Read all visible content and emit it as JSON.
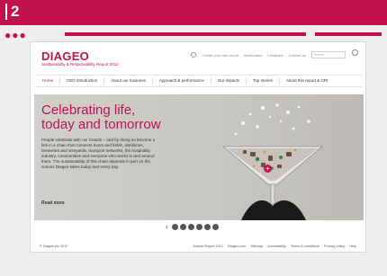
{
  "slide_number": "2",
  "brand": {
    "name": "DIAGEO",
    "subtitle": "Sustainability & Responsibility Report 2012"
  },
  "utility": {
    "create_report": "Create your own report",
    "bookmarks": "Bookmarks",
    "feedback": "Feedback",
    "contact": "Contact us",
    "search_placeholder": "Search"
  },
  "nav": [
    "Home",
    "CEO introduction",
    "About our business",
    "Approach & performance",
    "Our impacts",
    "Top stories",
    "About this report & GRI"
  ],
  "hero": {
    "headline_1": "Celebrating life,",
    "headline_2": "today and tomorrow",
    "body": "People celebrate with our brands – and by doing so become a link in a chain that connects rivers and fields, distilleries, breweries and vineyards, transport networks, the hospitality industry, communities and everyone who works in and around them. The sustainability of this chain depends in part on the actions Diageo takes today and every day.",
    "read_more": "Read more",
    "plus": "+"
  },
  "pager": {
    "current": "1"
  },
  "footer": {
    "copyright": "© Diageo plc 2012",
    "links": [
      "Annual Report 2012",
      "Diageo.com",
      "Sitemap",
      "Accessibility",
      "Terms & conditions",
      "Privacy policy",
      "Help"
    ]
  },
  "colors": {
    "accent": "#c0104e",
    "hero_bg": "#c7c5c1",
    "content_bg": "#eeeeee"
  }
}
